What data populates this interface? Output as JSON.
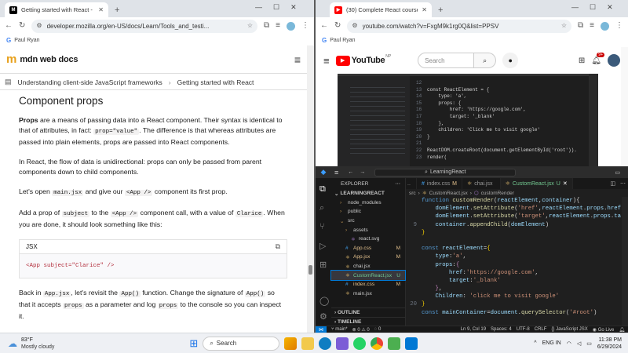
{
  "left_browser": {
    "tab_title": "Getting started with React - Lea",
    "url": "developer.mozilla.org/en-US/docs/Learn/Tools_and_testi...",
    "bookmark_user": "Paul Ryan",
    "logo_text": "mdn web docs",
    "breadcrumb": [
      "Understanding client-side JavaScript frameworks",
      "Getting started with React"
    ],
    "article": {
      "heading": "Component props",
      "p1_bold": "Props",
      "p1_a": " are a means of passing data into a React component. Their syntax is identical to that of attributes, in fact: ",
      "p1_code": "prop=\"value\"",
      "p1_b": ". The difference is that whereas attributes are passed into plain elements, props are passed into React components.",
      "p2": "In React, the flow of data is unidirectional: props can only be passed from parent components down to child components.",
      "p3_a": "Let's open ",
      "p3_code1": "main.jsx",
      "p3_b": " and give our ",
      "p3_code2": "<App />",
      "p3_c": " component its first prop.",
      "p4_a": "Add a prop of ",
      "p4_code1": "subject",
      "p4_b": " to the ",
      "p4_code2": "<App />",
      "p4_c": " component call, with a value of ",
      "p4_code3": "Clarice",
      "p4_d": ". When you are done, it should look something like this:",
      "code_lang": "JSX",
      "code_sample": "<App subject=\"Clarice\" />",
      "p5_a": "Back in ",
      "p5_code1": "App.jsx",
      "p5_b": ", let's revisit the ",
      "p5_code2": "App()",
      "p5_c": " function. Change the signature of ",
      "p5_code3": "App()",
      "p5_d": " so that it accepts ",
      "p5_code4": "props",
      "p5_e": " as a parameter and log ",
      "p5_code5": "props",
      "p5_f": " to the console so you can inspect it."
    }
  },
  "right_browser": {
    "tab_title": "(30) Complete React course wit",
    "url": "youtube.com/watch?v=FxgM9k1rg0Q&list=PPSV",
    "bookmark_user": "Paul Ryan",
    "yt_logo": "YouTube",
    "yt_region": "NP",
    "search_placeholder": "Search",
    "notif_count": "9+",
    "video_lines": [
      {
        "n": "12",
        "t": ""
      },
      {
        "n": "13",
        "t": "const ReactElement = {"
      },
      {
        "n": "14",
        "t": "    type: 'a',"
      },
      {
        "n": "15",
        "t": "    props: {"
      },
      {
        "n": "16",
        "t": "        href: 'https://google.com',"
      },
      {
        "n": "17",
        "t": "        target: '_blank'"
      },
      {
        "n": "18",
        "t": "    },"
      },
      {
        "n": "19",
        "t": "    children: 'Click me to visit google'"
      },
      {
        "n": "20",
        "t": "}"
      },
      {
        "n": "21",
        "t": ""
      },
      {
        "n": "22",
        "t": "ReactDOM.createRoot(document.getElementById('root'))."
      },
      {
        "n": "23",
        "t": "render("
      }
    ]
  },
  "vscode": {
    "title": "LearningReact",
    "explorer_label": "EXPLORER",
    "project": "LEARNINGREACT",
    "files": [
      {
        "name": "node_modules",
        "indent": 1,
        "kind": "folder",
        "badge": ""
      },
      {
        "name": "public",
        "indent": 1,
        "kind": "folder",
        "badge": ""
      },
      {
        "name": "src",
        "indent": 1,
        "kind": "folder-open",
        "badge": ""
      },
      {
        "name": "assets",
        "indent": 2,
        "kind": "folder",
        "badge": ""
      },
      {
        "name": "react.svg",
        "indent": 3,
        "kind": "file",
        "badge": ""
      },
      {
        "name": "App.css",
        "indent": 2,
        "kind": "css",
        "badge": "M"
      },
      {
        "name": "App.jsx",
        "indent": 2,
        "kind": "jsx",
        "badge": "M"
      },
      {
        "name": "chai.jsx",
        "indent": 2,
        "kind": "jsx",
        "badge": ""
      },
      {
        "name": "CustomReact.jsx",
        "indent": 2,
        "kind": "jsx",
        "badge": "U"
      },
      {
        "name": "index.css",
        "indent": 2,
        "kind": "css",
        "badge": "M"
      },
      {
        "name": "main.jsx",
        "indent": 2,
        "kind": "jsx",
        "badge": ""
      }
    ],
    "outline_label": "OUTLINE",
    "timeline_label": "TIMELINE",
    "tabs": [
      {
        "label": "index.css",
        "badge": "M",
        "active": false
      },
      {
        "label": "chai.jsx",
        "badge": "",
        "active": false
      },
      {
        "label": "CustomReact.jsx",
        "badge": "U",
        "active": true
      }
    ],
    "breadcrumb": [
      "src",
      "CustomReact.jsx",
      "customRender"
    ],
    "status": {
      "branch": "main*",
      "errors": "0",
      "warnings": "0",
      "ports": "0",
      "position": "Ln 9, Col 19",
      "spaces": "Spaces: 4",
      "encoding": "UTF-8",
      "eol": "CRLF",
      "lang": "JavaScript JSX",
      "golive": "Go Live"
    }
  },
  "taskbar": {
    "temp": "83°F",
    "weather": "Mostly cloudy",
    "search": "Search",
    "time": "11:38 PM",
    "date": "6/29/2024",
    "lang": "ENG IN"
  }
}
